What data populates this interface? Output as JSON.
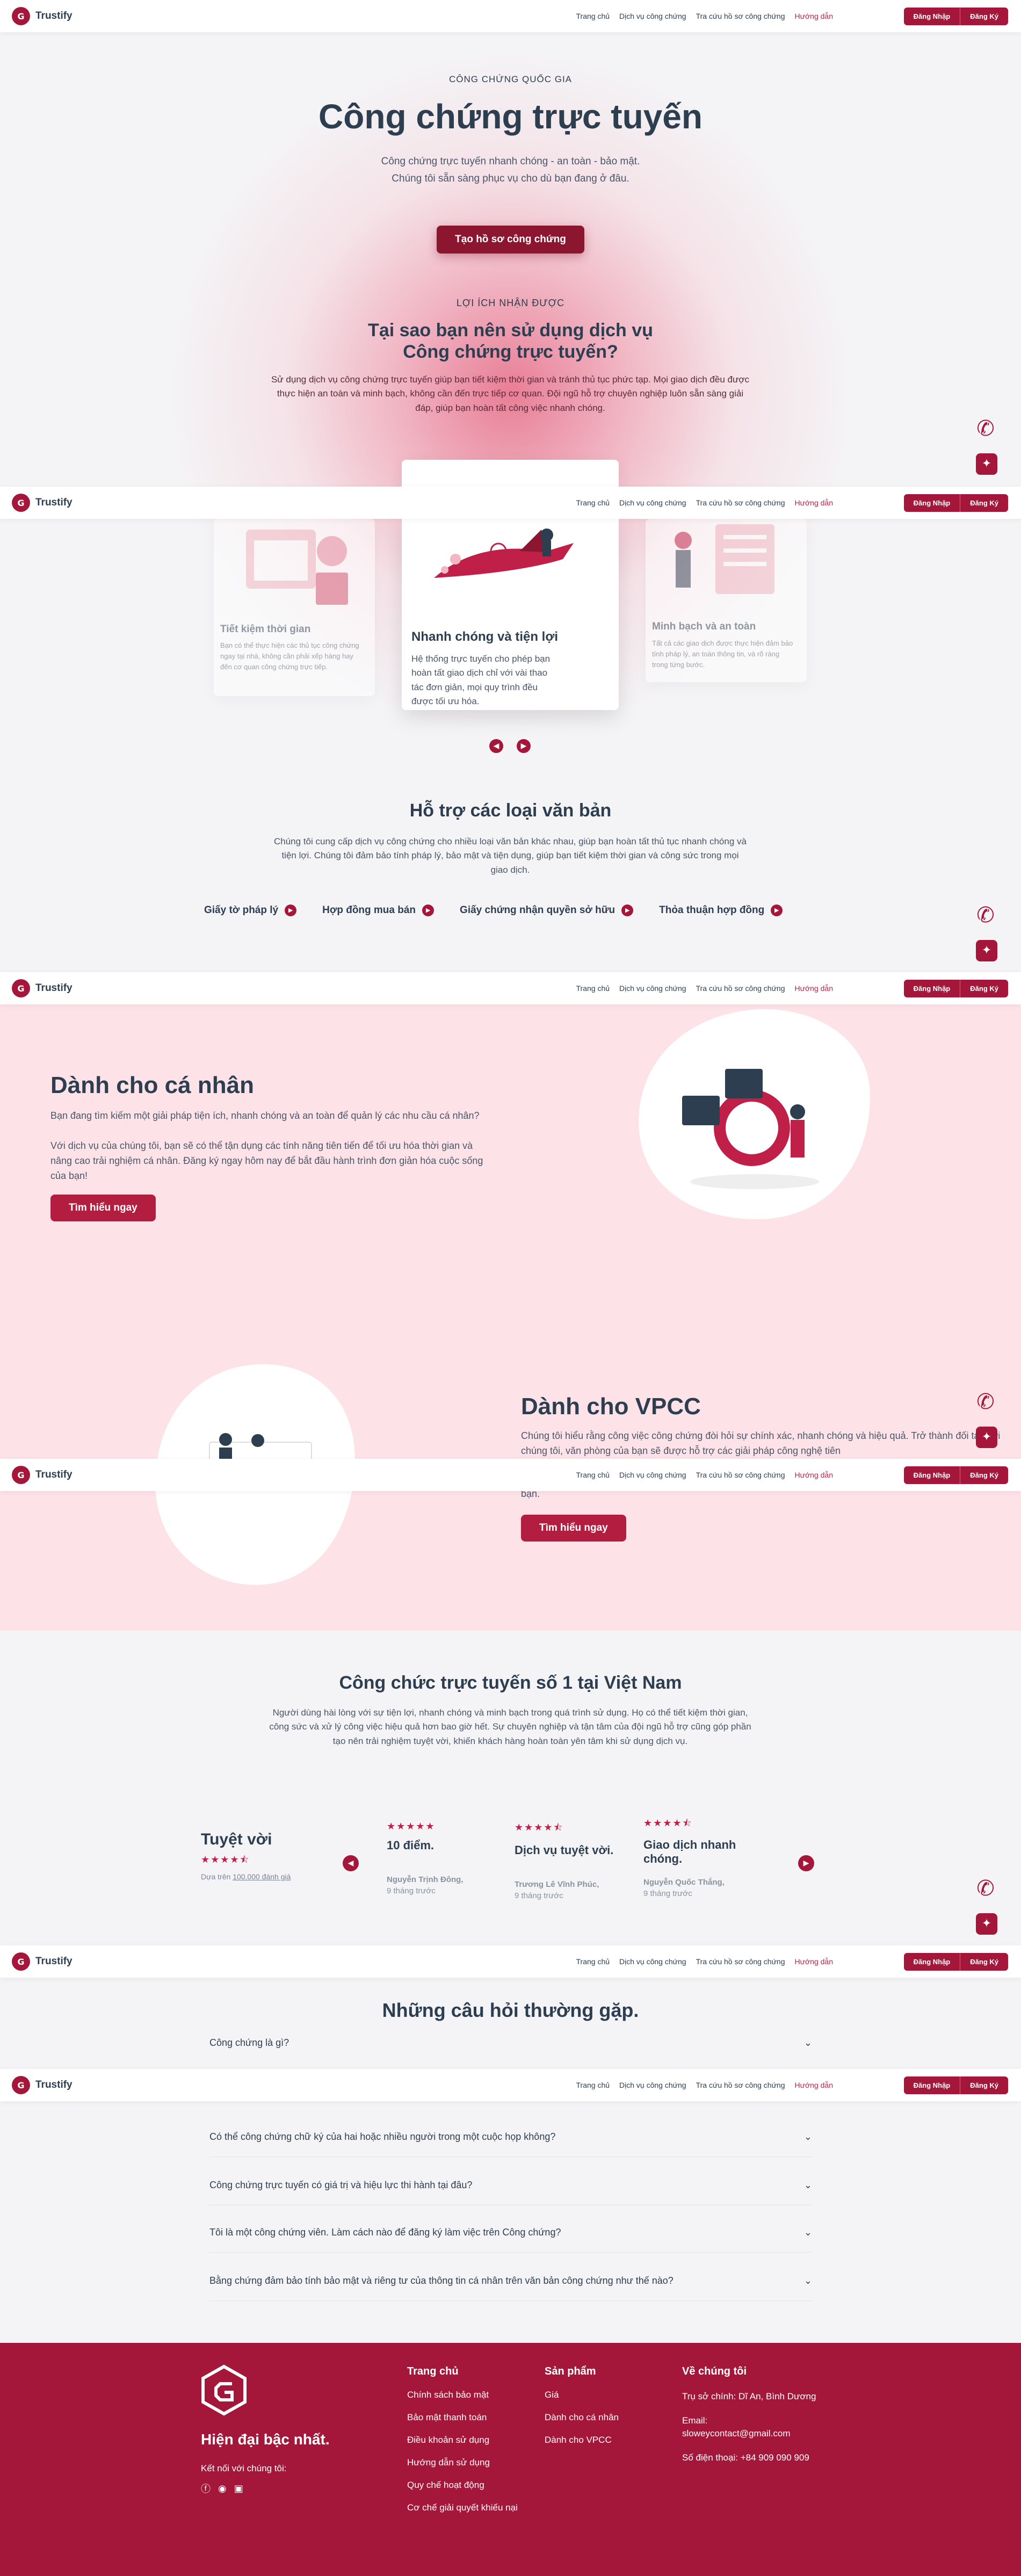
{
  "header": {
    "brand": "Trustify",
    "nav": [
      "Trang chủ",
      "Dịch vụ công chứng",
      "Tra cứu hồ sơ công chứng",
      "Hướng dẫn"
    ],
    "login_label": "Đăng Nhập",
    "register_label": "Đăng Ký"
  },
  "hero": {
    "eyebrow": "CÔNG CHỨNG QUỐC GIA",
    "title": "Công chứng trực tuyến",
    "subtitle_1": "Công chứng trực tuyến nhanh chóng - an toàn - bảo mật.",
    "subtitle_2": "Chúng tôi sẵn sàng phục vụ cho dù bạn đang ở đâu.",
    "cta": "Tạo hồ sơ công chứng"
  },
  "benefits": {
    "eyebrow": "LỢI ÍCH NHẬN ĐƯỢC",
    "title_1": "Tại sao bạn nên sử dụng dịch vụ",
    "title_2": "Công chứng trực tuyến?",
    "desc": "Sử dụng dịch vụ công chứng trực tuyến giúp bạn tiết kiệm thời gian và tránh thủ tục phức tạp. Mọi giao dịch đều được thực hiện an toàn và minh bạch, không cần đến trực tiếp cơ quan. Đội ngũ hỗ trợ chuyên nghiệp luôn sẵn sàng giải đáp, giúp bạn hoàn tất công việc nhanh chóng.",
    "cards": [
      {
        "title": "Tiết kiệm thời gian",
        "text": "Bạn có thể thực hiện các thủ tục công chứng ngay tại nhà, không cần phải xếp hàng hay đến cơ quan công chứng trực tiếp."
      },
      {
        "title": "Nhanh chóng và tiện lợi",
        "text": "Hệ thống trực tuyến cho phép bạn hoàn tất giao dịch chỉ với vài thao tác đơn giản, mọi quy trình đều được tối ưu hóa."
      },
      {
        "title": "Minh bạch và an toàn",
        "text": "Tất cả các giao dịch được thực hiện đảm bảo tính pháp lý, an toàn thông tin, và rõ ràng trong từng bước."
      }
    ]
  },
  "documents": {
    "title": "Hỗ trợ các loại văn bản",
    "desc": "Chúng tôi cung cấp dịch vụ công chứng cho nhiều loại văn bản khác nhau, giúp bạn hoàn tất thủ tục nhanh chóng và tiện lợi. Chúng tôi đảm bảo tính pháp lý, bảo mật và tiện dụng, giúp bạn tiết kiệm thời gian và công sức trong mọi giao dịch.",
    "types": [
      "Giấy tờ pháp lý",
      "Hợp đồng mua bán",
      "Giấy chứng nhận quyền sở hữu",
      "Thỏa thuận hợp đồng"
    ]
  },
  "personal": {
    "title": "Dành cho cá nhân",
    "desc_1": "Bạn đang tìm kiếm một giải pháp tiện ích, nhanh chóng và an toàn để quản lý các nhu cầu cá nhân?",
    "desc_2": "Với dịch vụ của chúng tôi, bạn sẽ có thể tận dụng các tính năng tiên tiến để tối ưu hóa thời gian và nâng cao trải nghiệm cá nhân. Đăng ký ngay hôm nay để bắt đầu hành trình đơn giản hóa cuộc sống của bạn!",
    "cta": "Tìm hiểu ngay"
  },
  "vpcc": {
    "title": "Dành cho VPCC",
    "desc_1": "Chúng tôi hiểu rằng công việc công chứng đòi hỏi sự chính xác, nhanh chóng và hiệu quả. Trở thành đối tác với chúng tôi, văn phòng của bạn sẽ được hỗ trợ các giải pháp công nghệ tiên",
    "desc_2": "bạn.",
    "cta": "Tìm hiểu ngay"
  },
  "reviews": {
    "title": "Công chức trực tuyến số 1 tại Việt Nam",
    "desc": "Người dùng hài lòng với sự tiện lợi, nhanh chóng và minh bạch trong quá trình sử dụng. Họ có thể tiết kiệm thời gian, công sức và xử lý công việc hiệu quả hơn bao giờ hết. Sự chuyên nghiệp và tận tâm của đội ngũ hỗ trợ cũng góp phần tạo nên trải nghiệm tuyệt vời, khiến khách hàng hoàn toàn yên tâm khi sử dụng dịch vụ.",
    "summary_title": "Tuyệt vời",
    "summary_prefix": "Dựa trên",
    "summary_count": "100.000 đánh giá",
    "items": [
      {
        "quote": "10 điểm.",
        "author": "Nguyễn Trịnh Đông,",
        "time": "9 tháng trước",
        "rating": 5
      },
      {
        "quote": "Dịch vụ tuyệt vời.",
        "author": "Trương Lê Vĩnh Phúc,",
        "time": "9 tháng trước",
        "rating": 4.5
      },
      {
        "quote": "Giao dịch nhanh chóng.",
        "author": "Nguyễn Quốc Thắng,",
        "time": "9 tháng trước",
        "rating": 4.5
      }
    ]
  },
  "faq": {
    "title": "Những câu hỏi thường gặp.",
    "items": [
      "Công chứng là gì?",
      "Có thể công chứng chữ ký của hai hoặc nhiều người trong một cuộc họp không?",
      "Công chứng trực tuyến có giá trị và hiệu lực thi hành tại đâu?",
      "Tôi là một công chứng viên. Làm cách nào để đăng ký làm việc trên Công chứng?",
      "Bằng chứng đảm bảo tính bảo mật và riêng tư của thông tin cá nhân trên văn bản công chứng như thế nào?"
    ]
  },
  "footer": {
    "tagline": "Hiện đại bậc nhất.",
    "connect": "Kết nối với chúng tôi:",
    "col1_title": "Trang chủ",
    "col1_links": [
      "Chính sách bảo mật",
      "Bảo mật thanh toán",
      "Điều khoản sử dụng",
      "Hướng dẫn sử dụng",
      "Quy chế hoạt động",
      "Cơ chế giải quyết khiếu nại"
    ],
    "col2_title": "Sản phẩm",
    "col2_links": [
      "Giá",
      "Dành cho cá nhân",
      "Dành cho VPCC"
    ],
    "col3_title": "Về chúng tôi",
    "address": "Trụ sở chính: Dĩ An, Bình Dương",
    "email_label": "Email:",
    "email": "sloweycontact@gmail.com",
    "phone": "Số điện thoại: +84 909 090 909"
  },
  "colors": {
    "primary": "#a5173a",
    "dark_primary": "#8c1530",
    "pink_bg": "#fde3e8",
    "text": "#2d3e50"
  },
  "icons": {
    "phone": "phone-icon",
    "chat": "chat-sparkle-icon",
    "arrow": "arrow-right-icon",
    "chevron": "chevron-down-icon"
  }
}
